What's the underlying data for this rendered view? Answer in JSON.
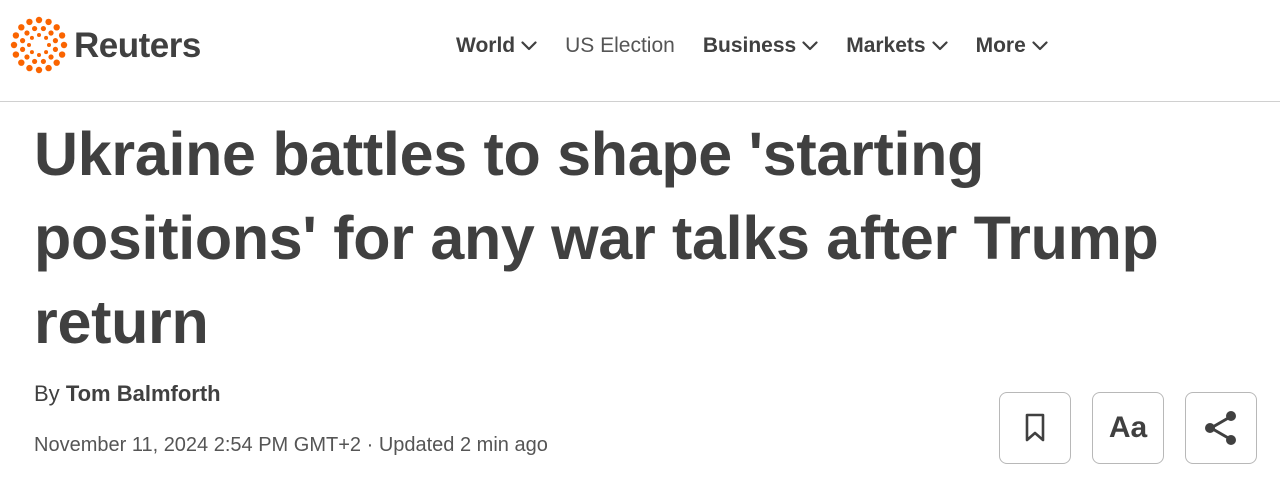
{
  "brand": {
    "name": "Reuters",
    "logo_icon": "reuters-dot-ring-icon",
    "logo_color": "#fa6400"
  },
  "nav": {
    "items": [
      {
        "label": "World",
        "has_dropdown": true
      },
      {
        "label": "US Election",
        "has_dropdown": false
      },
      {
        "label": "Business",
        "has_dropdown": true
      },
      {
        "label": "Markets",
        "has_dropdown": true
      },
      {
        "label": "More",
        "has_dropdown": true
      }
    ]
  },
  "article": {
    "headline": "Ukraine battles to shape 'starting positions' for any war talks after Trump return",
    "byline_prefix": "By",
    "author": "Tom Balmforth",
    "date": "November 11, 2024 2:54 PM GMT+2",
    "separator": "·",
    "updated": "Updated 2 min ago"
  },
  "tools": {
    "bookmark_icon": "bookmark-icon",
    "text_size_label": "Aa",
    "share_icon": "share-icon"
  },
  "colors": {
    "text": "#404040",
    "divider": "#d0d0d0",
    "border": "#b8b8b8"
  }
}
